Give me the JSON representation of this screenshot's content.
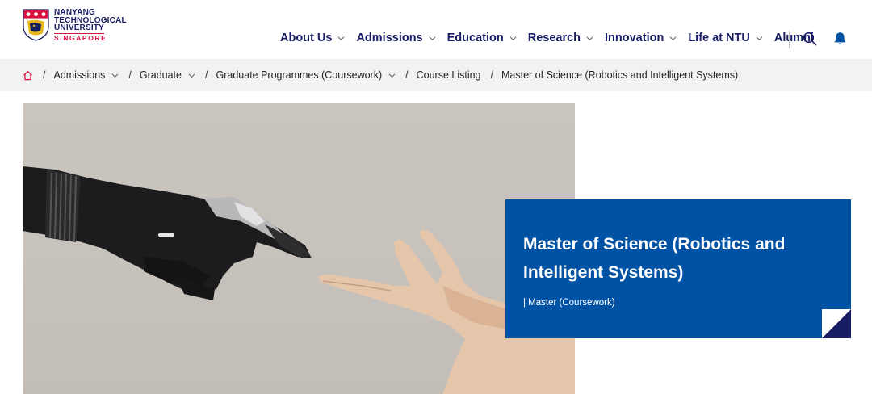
{
  "header": {
    "logo": {
      "line1": "NANYANG",
      "line2": "TECHNOLOGICAL",
      "line3": "UNIVERSITY",
      "line4": "SINGAPORE"
    },
    "nav": [
      {
        "label": "About Us",
        "has_dropdown": true
      },
      {
        "label": "Admissions",
        "has_dropdown": true
      },
      {
        "label": "Education",
        "has_dropdown": true
      },
      {
        "label": "Research",
        "has_dropdown": true
      },
      {
        "label": "Innovation",
        "has_dropdown": true
      },
      {
        "label": "Life at NTU",
        "has_dropdown": true
      },
      {
        "label": "Alumni",
        "has_dropdown": false
      }
    ],
    "icons": {
      "search": "search-icon",
      "notifications": "bell-icon"
    }
  },
  "breadcrumb": {
    "home_icon": "home-icon",
    "separator": "/",
    "items": [
      {
        "label": "Admissions",
        "has_dropdown": true
      },
      {
        "label": "Graduate",
        "has_dropdown": true
      },
      {
        "label": "Graduate Programmes (Coursework)",
        "has_dropdown": true
      },
      {
        "label": "Course Listing",
        "has_dropdown": false
      }
    ],
    "current": "Master of Science (Robotics and Intelligent Systems)"
  },
  "hero": {
    "card_title": "Master of Science (Robotics and Intelligent Systems)",
    "card_subtitle": "| Master (Coursework)"
  },
  "colors": {
    "navy": "#181c62",
    "brand_red": "#d71440",
    "card_blue": "#0052a5",
    "breadcrumb_bg": "#f2f2f2"
  }
}
